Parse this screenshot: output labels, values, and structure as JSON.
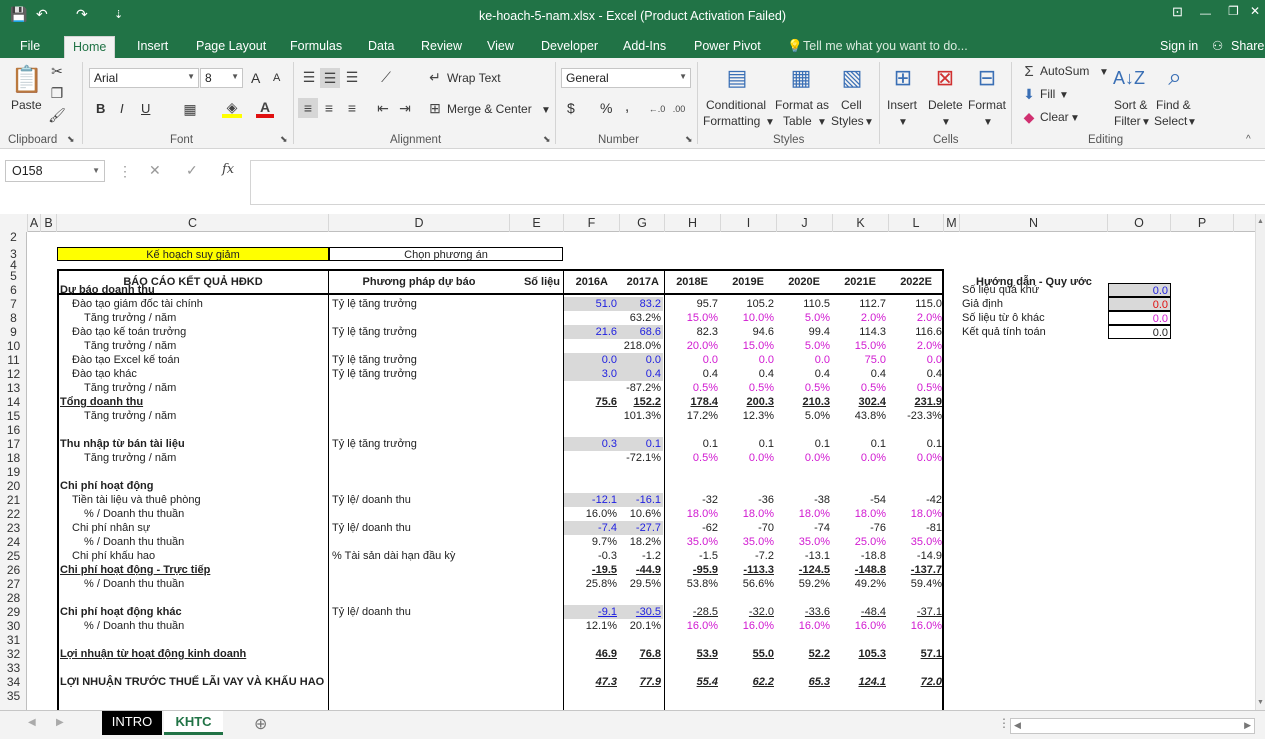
{
  "window": {
    "title": "ke-hoach-5-nam.xlsx - Excel (Product Activation Failed)",
    "qa_save": "💾",
    "qa_undo": "↶",
    "qa_redo": "↷",
    "qa_custom": "⇣",
    "win_ribbon": "⊡",
    "win_min": "—",
    "win_max": "❐",
    "win_close": "✕"
  },
  "tabs": [
    "File",
    "Home",
    "Insert",
    "Page Layout",
    "Formulas",
    "Data",
    "Review",
    "View",
    "Developer",
    "Add-Ins",
    "Power Pivot"
  ],
  "tell_me": "Tell me what you want to do...",
  "sign_in": "Sign in",
  "share": "Share",
  "ribbon": {
    "clipboard": {
      "paste": "Paste",
      "group": "Clipboard"
    },
    "font": {
      "name": "Arial",
      "size": "8",
      "bold": "B",
      "italic": "I",
      "underline": "U",
      "grow": "A",
      "shrink": "A",
      "group": "Font"
    },
    "alignment": {
      "wrap": "Wrap Text",
      "merge": "Merge & Center",
      "group": "Alignment"
    },
    "number": {
      "format": "General",
      "currency": "$",
      "percent": "%",
      "comma": ",",
      "group": "Number"
    },
    "styles": {
      "conditional1": "Conditional",
      "conditional2": "Formatting",
      "format_table1": "Format as",
      "format_table2": "Table",
      "cell_styles1": "Cell",
      "cell_styles2": "Styles",
      "group": "Styles"
    },
    "cells": {
      "insert": "Insert",
      "delete": "Delete",
      "format": "Format",
      "group": "Cells"
    },
    "editing": {
      "autosum": "AutoSum",
      "fill": "Fill",
      "clear": "Clear",
      "sort1": "Sort &",
      "sort2": "Filter",
      "find1": "Find &",
      "find2": "Select",
      "group": "Editing"
    }
  },
  "formula_bar": {
    "name_box": "O158",
    "fx": "fx",
    "cancel": "✕",
    "enter": "✓",
    "content": ""
  },
  "columns": [
    "A",
    "B",
    "C",
    "D",
    "E",
    "F",
    "G",
    "H",
    "I",
    "J",
    "K",
    "L",
    "M",
    "N",
    "O",
    "P"
  ],
  "rows": [
    "2",
    "3",
    "4",
    "5",
    "6",
    "7",
    "8",
    "9",
    "10",
    "11",
    "12",
    "13",
    "14",
    "15",
    "16",
    "17",
    "18",
    "19",
    "20",
    "21",
    "22",
    "23",
    "24",
    "25",
    "26",
    "27",
    "28",
    "29",
    "30",
    "31",
    "32",
    "33",
    "34",
    "35"
  ],
  "sheet": {
    "plan_label": "Kế hoạch suy giảm",
    "choose_label": "Chọn phương án",
    "header": {
      "report": "BÁO CÁO KẾT QUẢ HĐKD",
      "method": "Phương pháp dự báo",
      "data": "Số liệu",
      "y2016": "2016A",
      "y2017": "2017A",
      "y2018": "2018E",
      "y2019": "2019E",
      "y2020": "2020E",
      "y2021": "2021E",
      "y2022": "2022E"
    },
    "rows": [
      {
        "row": "6",
        "label": "Dự báo doanh thu",
        "cls": "b",
        "method": "",
        "f": "",
        "g": "",
        "v": [
          "",
          "",
          "",
          "",
          ""
        ],
        "vc": ""
      },
      {
        "row": "7",
        "label": "Đào tạo giám đốc tài chính",
        "indent": 1,
        "method": "Tỷ lệ tăng trưởng",
        "f": "51.0",
        "g": "83.2",
        "fc": "blue grey",
        "v": [
          "95.7",
          "105.2",
          "110.5",
          "112.7",
          "115.0"
        ],
        "vc": ""
      },
      {
        "row": "8",
        "label": "Tăng trưởng / năm",
        "indent": 2,
        "method": "",
        "f": "",
        "g": "63.2%",
        "v": [
          "15.0%",
          "10.0%",
          "5.0%",
          "2.0%",
          "2.0%"
        ],
        "vc": "mag"
      },
      {
        "row": "9",
        "label": "Đào tạo kế toán trưởng",
        "indent": 1,
        "method": "Tỷ lệ tăng trưởng",
        "f": "21.6",
        "g": "68.6",
        "fc": "blue grey",
        "v": [
          "82.3",
          "94.6",
          "99.4",
          "114.3",
          "116.6"
        ],
        "vc": ""
      },
      {
        "row": "10",
        "label": "Tăng trưởng / năm",
        "indent": 2,
        "method": "",
        "f": "",
        "g": "218.0%",
        "v": [
          "20.0%",
          "15.0%",
          "5.0%",
          "15.0%",
          "2.0%"
        ],
        "vc": "mag"
      },
      {
        "row": "11",
        "label": "Đào tạo Excel kế toán",
        "indent": 1,
        "method": "Tỷ lệ tăng trưởng",
        "f": "0.0",
        "g": "0.0",
        "fc": "blue grey",
        "v": [
          "0.0",
          "0.0",
          "0.0",
          "75.0",
          "0.0"
        ],
        "vc": "mag"
      },
      {
        "row": "12",
        "label": "Đào tạo khác",
        "indent": 1,
        "method": "Tỷ lệ tăng trưởng",
        "f": "3.0",
        "g": "0.4",
        "fc": "blue grey",
        "v": [
          "0.4",
          "0.4",
          "0.4",
          "0.4",
          "0.4"
        ],
        "vc": ""
      },
      {
        "row": "13",
        "label": "Tăng trưởng / năm",
        "indent": 2,
        "method": "",
        "f": "",
        "g": "-87.2%",
        "v": [
          "0.5%",
          "0.5%",
          "0.5%",
          "0.5%",
          "0.5%"
        ],
        "vc": "mag"
      },
      {
        "row": "14",
        "label": "Tổng doanh thu",
        "cls": "b u",
        "method": "",
        "f": "75.6",
        "g": "152.2",
        "fc": "b u",
        "v": [
          "178.4",
          "200.3",
          "210.3",
          "302.4",
          "231.9"
        ],
        "vc": "b u"
      },
      {
        "row": "15",
        "label": "Tăng trưởng / năm",
        "indent": 2,
        "method": "",
        "f": "",
        "g": "101.3%",
        "v": [
          "17.2%",
          "12.3%",
          "5.0%",
          "43.8%",
          "-23.3%"
        ],
        "vc": ""
      },
      {
        "row": "16",
        "label": "",
        "method": "",
        "f": "",
        "g": "",
        "v": [
          "",
          "",
          "",
          "",
          ""
        ],
        "vc": ""
      },
      {
        "row": "17",
        "label": "Thu nhập từ bán tài liệu",
        "cls": "b",
        "method": "Tỷ lệ tăng trưởng",
        "f": "0.3",
        "g": "0.1",
        "fc": "blue grey",
        "v": [
          "0.1",
          "0.1",
          "0.1",
          "0.1",
          "0.1"
        ],
        "vc": ""
      },
      {
        "row": "18",
        "label": "Tăng trưởng / năm",
        "indent": 2,
        "method": "",
        "f": "",
        "g": "-72.1%",
        "v": [
          "0.5%",
          "0.0%",
          "0.0%",
          "0.0%",
          "0.0%"
        ],
        "vc": "mag"
      },
      {
        "row": "19",
        "label": "",
        "method": "",
        "f": "",
        "g": "",
        "v": [
          "",
          "",
          "",
          "",
          ""
        ],
        "vc": ""
      },
      {
        "row": "20",
        "label": "Chi phí hoạt động",
        "cls": "b",
        "method": "",
        "f": "",
        "g": "",
        "v": [
          "",
          "",
          "",
          "",
          ""
        ],
        "vc": ""
      },
      {
        "row": "21",
        "label": "Tiền tài liệu và thuê phòng",
        "indent": 1,
        "method": "Tỷ lệ/ doanh thu",
        "f": "-12.1",
        "g": "-16.1",
        "fc": "blue grey",
        "v": [
          "-32",
          "-36",
          "-38",
          "-54",
          "-42"
        ],
        "vc": ""
      },
      {
        "row": "22",
        "label": "% / Doanh thu thuần",
        "indent": 2,
        "method": "",
        "f": "16.0%",
        "g": "10.6%",
        "v": [
          "18.0%",
          "18.0%",
          "18.0%",
          "18.0%",
          "18.0%"
        ],
        "vc": "mag"
      },
      {
        "row": "23",
        "label": "Chi phí nhân sự",
        "indent": 1,
        "method": "Tỷ lệ/ doanh thu",
        "f": "-7.4",
        "g": "-27.7",
        "fc": "blue grey",
        "v": [
          "-62",
          "-70",
          "-74",
          "-76",
          "-81"
        ],
        "vc": ""
      },
      {
        "row": "24",
        "label": "% / Doanh thu thuần",
        "indent": 2,
        "method": "",
        "f": "9.7%",
        "g": "18.2%",
        "v": [
          "35.0%",
          "35.0%",
          "35.0%",
          "25.0%",
          "35.0%"
        ],
        "vc": "mag"
      },
      {
        "row": "25",
        "label": "Chi phí khấu hao",
        "indent": 1,
        "method": "% Tài sản dài hạn đầu kỳ",
        "f": "-0.3",
        "g": "-1.2",
        "v": [
          "-1.5",
          "-7.2",
          "-13.1",
          "-18.8",
          "-14.9"
        ],
        "vc": ""
      },
      {
        "row": "26",
        "label": "Chi phí hoạt động - Trực tiếp",
        "cls": "b u",
        "method": "",
        "f": "-19.5",
        "g": "-44.9",
        "fc": "b u",
        "v": [
          "-95.9",
          "-113.3",
          "-124.5",
          "-148.8",
          "-137.7"
        ],
        "vc": "b u"
      },
      {
        "row": "27",
        "label": "% / Doanh thu thuần",
        "indent": 2,
        "method": "",
        "f": "25.8%",
        "g": "29.5%",
        "v": [
          "53.8%",
          "56.6%",
          "59.2%",
          "49.2%",
          "59.4%"
        ],
        "vc": ""
      },
      {
        "row": "28",
        "label": "",
        "method": "",
        "f": "",
        "g": "",
        "v": [
          "",
          "",
          "",
          "",
          ""
        ],
        "vc": ""
      },
      {
        "row": "29",
        "label": "Chi phí hoạt động khác",
        "cls": "b",
        "method": "Tỷ lệ/ doanh thu",
        "f": "-9.1",
        "g": "-30.5",
        "fc": "blue grey u",
        "v": [
          "-28.5",
          "-32.0",
          "-33.6",
          "-48.4",
          "-37.1"
        ],
        "vc": "u"
      },
      {
        "row": "30",
        "label": "% / Doanh thu thuần",
        "indent": 2,
        "method": "",
        "f": "12.1%",
        "g": "20.1%",
        "v": [
          "16.0%",
          "16.0%",
          "16.0%",
          "16.0%",
          "16.0%"
        ],
        "vc": "mag"
      },
      {
        "row": "31",
        "label": "",
        "method": "",
        "f": "",
        "g": "",
        "v": [
          "",
          "",
          "",
          "",
          ""
        ],
        "vc": ""
      },
      {
        "row": "32",
        "label": "Lợi nhuận từ hoạt động kinh doanh",
        "cls": "b u",
        "method": "",
        "f": "46.9",
        "g": "76.8",
        "fc": "b u",
        "v": [
          "53.9",
          "55.0",
          "52.2",
          "105.3",
          "57.1"
        ],
        "vc": "b u"
      },
      {
        "row": "33",
        "label": "",
        "method": "",
        "f": "",
        "g": "",
        "v": [
          "",
          "",
          "",
          "",
          ""
        ],
        "vc": ""
      },
      {
        "row": "34",
        "label": "LỢI NHUẬN TRƯỚC THUẾ LÃI VAY VÀ KHẤU HAO",
        "cls": "b",
        "method": "",
        "f": "47.3",
        "g": "77.9",
        "fc": "bi u",
        "v": [
          "55.4",
          "62.2",
          "65.3",
          "124.1",
          "72.0"
        ],
        "vc": "bi u"
      }
    ],
    "legend": {
      "title": "Hướng dẫn - Quy ước",
      "items": [
        {
          "label": "Số liệu quá khứ",
          "value": "0.0",
          "cls": "blue grey"
        },
        {
          "label": "Giả định",
          "value": "0.0",
          "cls": "red grey"
        },
        {
          "label": "Số liệu từ ô khác",
          "value": "0.0",
          "cls": "mag"
        },
        {
          "label": "Kết quả tính toán",
          "value": "0.0",
          "cls": ""
        }
      ]
    }
  },
  "sheet_tabs": [
    "INTRO",
    "KHTC"
  ],
  "colors": {
    "excel_green": "#217346",
    "grey_input": "#d9d9d9",
    "yellow": "#ffff00",
    "blue": "#1f1fe0",
    "magenta": "#d11ad1",
    "red": "#e01010"
  }
}
